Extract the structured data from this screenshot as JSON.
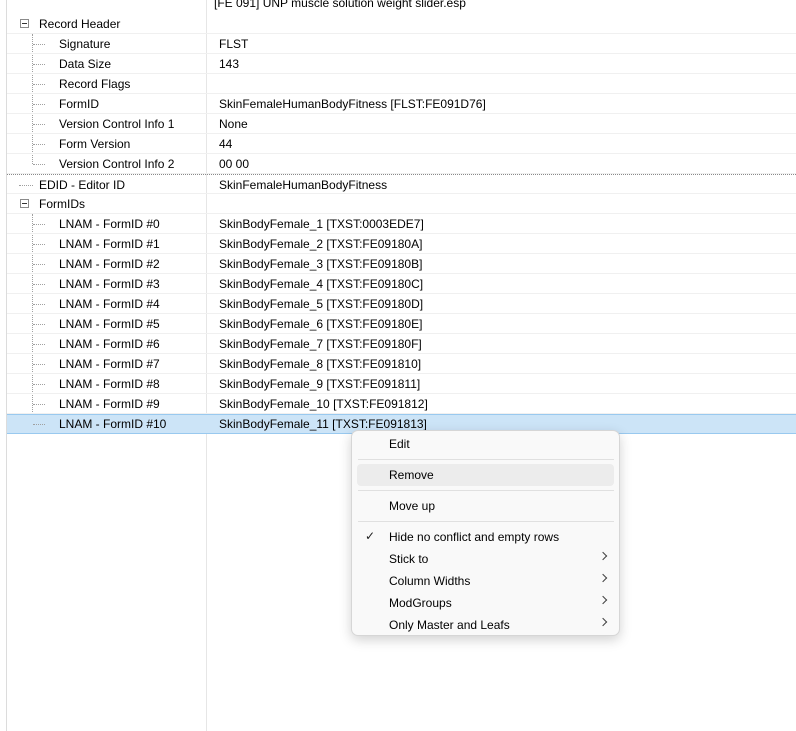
{
  "header": {
    "file_text": "[FE 091] UNP muscle solution weight slider.esp"
  },
  "rows": [
    {
      "label": "Record Header",
      "value": ""
    },
    {
      "label": "Signature",
      "value": "FLST"
    },
    {
      "label": "Data Size",
      "value": "143"
    },
    {
      "label": "Record Flags",
      "value": ""
    },
    {
      "label": "FormID",
      "value": "SkinFemaleHumanBodyFitness [FLST:FE091D76]"
    },
    {
      "label": "Version Control Info 1",
      "value": "None"
    },
    {
      "label": "Form Version",
      "value": "44"
    },
    {
      "label": "Version Control Info 2",
      "value": "00 00"
    },
    {
      "label": "EDID - Editor ID",
      "value": "SkinFemaleHumanBodyFitness"
    },
    {
      "label": "FormIDs",
      "value": ""
    },
    {
      "label": "LNAM - FormID #0",
      "value": "SkinBodyFemale_1 [TXST:0003EDE7]"
    },
    {
      "label": "LNAM - FormID #1",
      "value": "SkinBodyFemale_2 [TXST:FE09180A]"
    },
    {
      "label": "LNAM - FormID #2",
      "value": "SkinBodyFemale_3 [TXST:FE09180B]"
    },
    {
      "label": "LNAM - FormID #3",
      "value": "SkinBodyFemale_4 [TXST:FE09180C]"
    },
    {
      "label": "LNAM - FormID #4",
      "value": "SkinBodyFemale_5 [TXST:FE09180D]"
    },
    {
      "label": "LNAM - FormID #5",
      "value": "SkinBodyFemale_6 [TXST:FE09180E]"
    },
    {
      "label": "LNAM - FormID #6",
      "value": "SkinBodyFemale_7 [TXST:FE09180F]"
    },
    {
      "label": "LNAM - FormID #7",
      "value": "SkinBodyFemale_8 [TXST:FE091810]"
    },
    {
      "label": "LNAM - FormID #8",
      "value": "SkinBodyFemale_9 [TXST:FE091811]"
    },
    {
      "label": "LNAM - FormID #9",
      "value": "SkinBodyFemale_10 [TXST:FE091812]"
    },
    {
      "label": "LNAM - FormID #10",
      "value": "SkinBodyFemale_11 [TXST:FE091813]"
    }
  ],
  "context_menu": {
    "items": [
      {
        "label": "Edit"
      },
      {
        "label": "Remove"
      },
      {
        "label": "Move up"
      },
      {
        "label": "Hide no conflict and empty rows",
        "check": "✓"
      },
      {
        "label": "Stick to"
      },
      {
        "label": "Column Widths"
      },
      {
        "label": "ModGroups"
      },
      {
        "label": "Only Master and Leafs"
      }
    ]
  },
  "colors": {
    "selection": "#cce4f7",
    "menu_background": "#f9f9f9",
    "menu_hover": "#ececec"
  }
}
